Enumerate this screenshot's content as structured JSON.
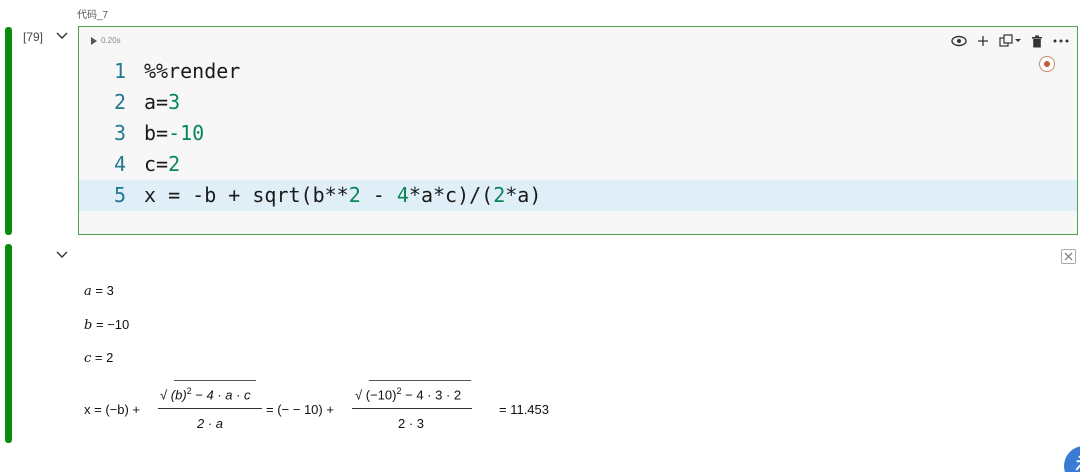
{
  "cell": {
    "label": "代码_7",
    "exec_count": "[79]",
    "run_time": "0.20s"
  },
  "code_lines": [
    {
      "num": "1",
      "text": "%%render"
    },
    {
      "num": "2",
      "text": "a=",
      "lit": "3"
    },
    {
      "num": "3",
      "text": "b=",
      "lit": "-10"
    },
    {
      "num": "4",
      "text": "c=",
      "lit": "2"
    },
    {
      "num": "5",
      "text": "x = -b + sqrt(b**2 - 4*a*c)/(2*a)"
    }
  ],
  "toolbar": {
    "icons": [
      "eye-icon",
      "plus-icon",
      "copy-dropdown-icon",
      "trash-icon",
      "more-icon"
    ]
  },
  "output": {
    "a_var": "a",
    "a_val": " = 3",
    "b_var": "b",
    "b_val": " = −10",
    "c_var": "c",
    "c_val": " = 2",
    "eq": {
      "lhs": "x = (−b) +",
      "num1_sqrt": "√",
      "num1_expr": "(b)",
      "num1_exp": "2",
      "num1_rest": " − 4 · a · c",
      "den1": "2 · a",
      "mid": "= (− − 10) +",
      "num2_sqrt": "√",
      "num2_expr": "(−10)",
      "num2_exp": "2",
      "num2_rest": " − 4 · 3 · 2",
      "den2": "2 · 3",
      "result": "= 11.453"
    }
  },
  "colors": {
    "run_bar": "#0b8a0b",
    "editor_border": "#4ea14e",
    "line_number": "#237893",
    "number_literal": "#098658",
    "highlight_line": "#dfeef7"
  }
}
